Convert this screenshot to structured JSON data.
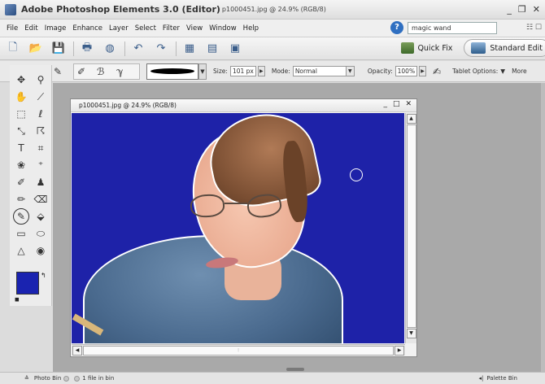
{
  "app": {
    "title_bold": "Adobe Photoshop Elements 3.0 (Editor)",
    "title_doc": " p1000451.jpg @ 24.9% (RGB/8)",
    "win_min": "_",
    "win_restore": "❐",
    "win_close": "✕"
  },
  "menu": {
    "items": [
      "File",
      "Edit",
      "Image",
      "Enhance",
      "Layer",
      "Select",
      "Filter",
      "View",
      "Window",
      "Help"
    ],
    "search_value": "magic wand",
    "extra": "☷ ☐"
  },
  "modes": {
    "quick_fix": "Quick Fix",
    "standard_edit": "Standard Edit"
  },
  "options": {
    "size_label": "Size:",
    "size_value": "101 px",
    "mode_label": "Mode:",
    "mode_value": "Normal",
    "opacity_label": "Opacity:",
    "opacity_value": "100%",
    "tablet_label": "Tablet Options:",
    "more_label": "More"
  },
  "document": {
    "title": "p1000451.jpg @ 24.9% (RGB/8)",
    "min": "_",
    "restore": "□",
    "close": "✕"
  },
  "colors": {
    "foreground": "#1a23b0",
    "background": "#ffffff",
    "canvas_bg": "#1e22a8"
  },
  "status": {
    "photo_bin": "Photo Bin",
    "files_in_bin": "1 file in bin",
    "palette_bin": "Palette Bin"
  }
}
